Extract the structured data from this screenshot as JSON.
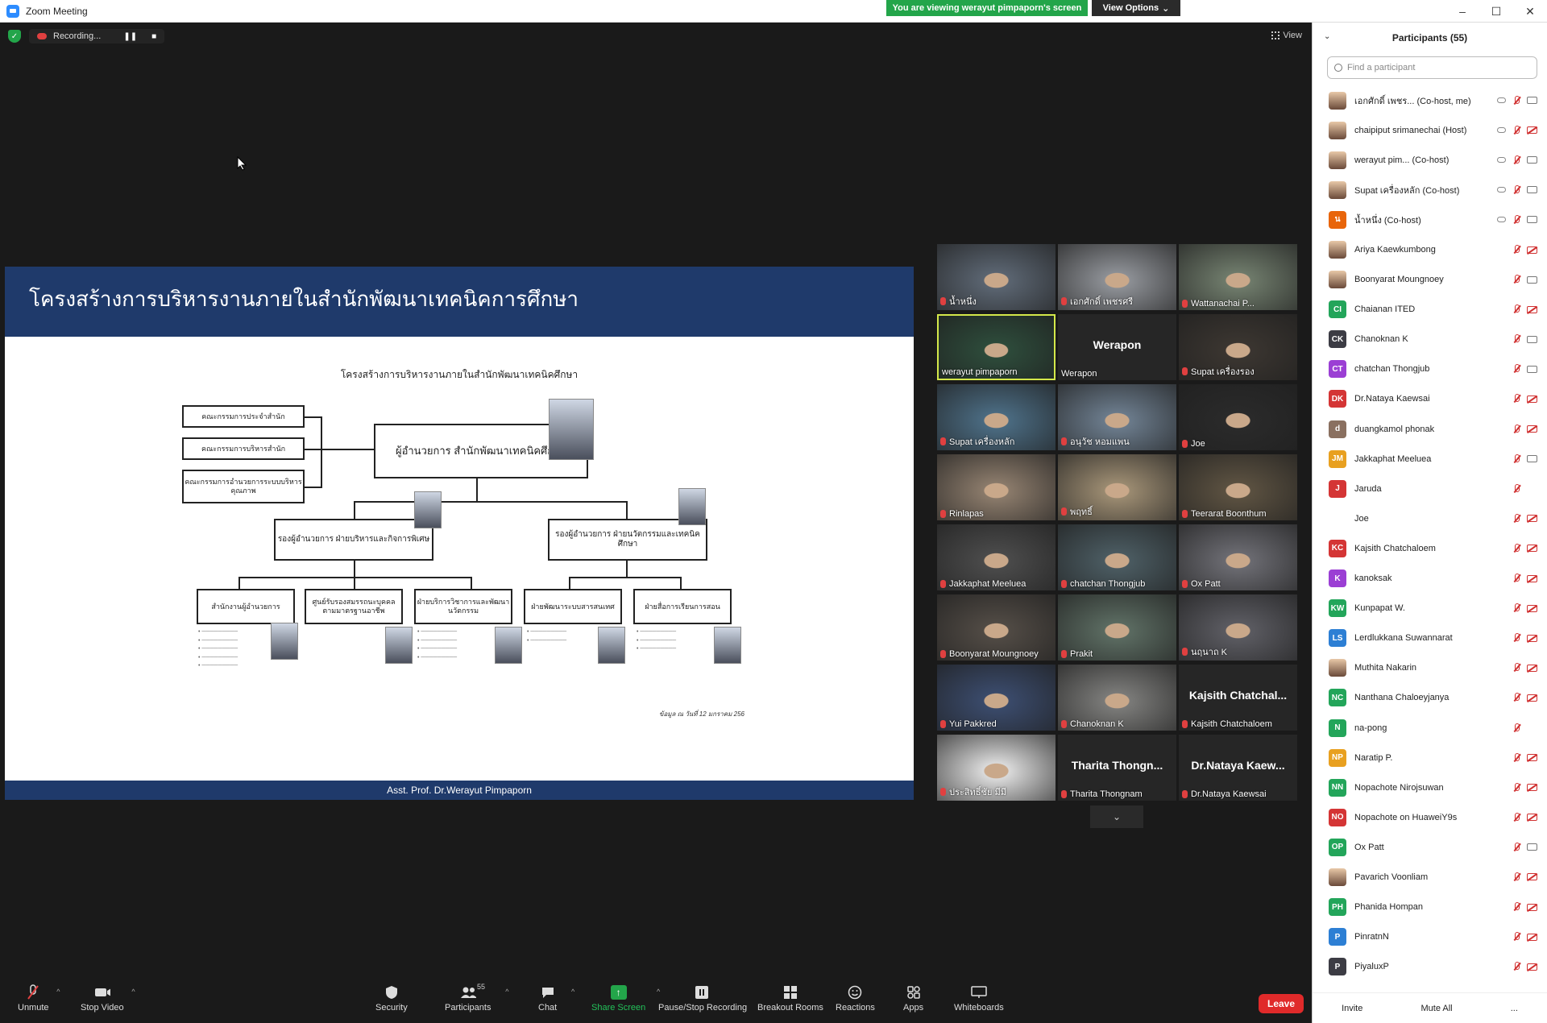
{
  "window": {
    "title": "Zoom Meeting"
  },
  "banner": {
    "viewing_text": "You are viewing werayut pimpaporn's screen",
    "view_options": "View Options"
  },
  "stage": {
    "recording_label": "Recording...",
    "view_label": "View"
  },
  "slide": {
    "header": "โครงสร้างการบริหารงานภายในสำนักพัฒนาเทคนิคการศึกษา",
    "chart_title": "โครงสร้างการบริหารงานภายในสำนักพัฒนาเทคนิคศึกษา",
    "committees": [
      "คณะกรรมการประจำสำนัก",
      "คณะกรรมการบริหารสำนัก",
      "คณะกรรมการอำนวยการระบบบริหารคุณภาพ"
    ],
    "director": "ผู้อำนวยการ สำนักพัฒนาเทคนิคศึกษา",
    "deputies": [
      "รองผู้อำนวยการ ฝ่ายบริหารและกิจการพิเศษ",
      "รองผู้อำนวยการ ฝ่ายนวัตกรรมและเทคนิคศึกษา"
    ],
    "units": [
      "สำนักงานผู้อำนวยการ",
      "ศูนย์รับรองสมรรถนะบุคคลตามมาตรฐานอาชีพ",
      "ฝ่ายบริการวิชาการและพัฒนานวัตกรรม",
      "ฝ่ายพัฒนาระบบสารสนเทศ",
      "ฝ่ายสื่อการเรียนการสอน"
    ],
    "date_note": "ข้อมูล ณ วันที่ 12 มกราคม 256",
    "footer": "Asst. Prof. Dr.Werayut Pimpaporn"
  },
  "video_tiles": [
    {
      "name": "น้ำหนึ่ง",
      "big": ""
    },
    {
      "name": "เอกศักดิ์  เพชรศรี",
      "big": ""
    },
    {
      "name": "Wattanachai P...",
      "big": ""
    },
    {
      "name": "werayut pimpaporn",
      "big": ""
    },
    {
      "name": "Werapon",
      "big": "Werapon"
    },
    {
      "name": "Supat เครื่องรอง",
      "big": ""
    },
    {
      "name": "Supat เครื่องหลัก",
      "big": ""
    },
    {
      "name": "อนุวัช  หอมแพน",
      "big": ""
    },
    {
      "name": "Joe",
      "big": ""
    },
    {
      "name": "Rinlapas",
      "big": ""
    },
    {
      "name": "พฤทธิ์",
      "big": ""
    },
    {
      "name": "Teerarat Boonthum",
      "big": ""
    },
    {
      "name": "Jakkaphat Meeluea",
      "big": ""
    },
    {
      "name": "chatchan Thongjub",
      "big": ""
    },
    {
      "name": "Ox Patt",
      "big": ""
    },
    {
      "name": "Boonyarat Moungnoey",
      "big": ""
    },
    {
      "name": "Prakit",
      "big": ""
    },
    {
      "name": "นฤนาถ  K",
      "big": ""
    },
    {
      "name": "Yui Pakkred",
      "big": ""
    },
    {
      "name": "Chanoknan K",
      "big": ""
    },
    {
      "name": "Kajsith Chatchaloem",
      "big": "Kajsith  Chatchal..."
    },
    {
      "name": "ประสิทธิ์ชัย  มีมี",
      "big": ""
    },
    {
      "name": "Tharita Thongnam",
      "big": "Tharita  Thongn..."
    },
    {
      "name": "Dr.Nataya Kaewsai",
      "big": "Dr.Nataya  Kaew..."
    }
  ],
  "panel": {
    "title": "Participants (55)",
    "search_placeholder": "Find a participant",
    "participants": [
      {
        "name": "เอกศักดิ์  เพชร...  (Co-host, me)",
        "initials": "",
        "color": "",
        "cam": "on",
        "cloud": true
      },
      {
        "name": "chaipiput srimanechai (Host)",
        "initials": "",
        "color": "",
        "cam": "off",
        "cloud": true
      },
      {
        "name": "werayut pim...  (Co-host)",
        "initials": "",
        "color": "",
        "cam": "on",
        "cloud": true
      },
      {
        "name": "Supat เครื่องหลัก (Co-host)",
        "initials": "",
        "color": "",
        "cam": "on",
        "cloud": true
      },
      {
        "name": "น้ำหนึ่ง (Co-host)",
        "initials": "น",
        "color": "#e8650a",
        "cam": "on",
        "cloud": true
      },
      {
        "name": "Ariya Kaewkumbong",
        "initials": "",
        "color": "",
        "cam": "off",
        "cloud": false
      },
      {
        "name": "Boonyarat Moungnoey",
        "initials": "",
        "color": "",
        "cam": "on",
        "cloud": false
      },
      {
        "name": "Chaianan ITED",
        "initials": "CI",
        "color": "#23a55a",
        "cam": "off",
        "cloud": false
      },
      {
        "name": "Chanoknan K",
        "initials": "CK",
        "color": "#3c3c44",
        "cam": "on",
        "cloud": false
      },
      {
        "name": "chatchan Thongjub",
        "initials": "CT",
        "color": "#9b3fd4",
        "cam": "on",
        "cloud": false
      },
      {
        "name": "Dr.Nataya Kaewsai",
        "initials": "DK",
        "color": "#d43535",
        "cam": "off",
        "cloud": false
      },
      {
        "name": "duangkamol phonak",
        "initials": "d",
        "color": "#8a7060",
        "cam": "off",
        "cloud": false
      },
      {
        "name": "Jakkaphat Meeluea",
        "initials": "JM",
        "color": "#e8a020",
        "cam": "on",
        "cloud": false
      },
      {
        "name": "Jaruda",
        "initials": "J",
        "color": "#d43535",
        "cam": "none",
        "cloud": false
      },
      {
        "name": "Joe",
        "initials": "",
        "color": "#ffffff",
        "cam": "off",
        "cloud": false
      },
      {
        "name": "Kajsith Chatchaloem",
        "initials": "KC",
        "color": "#d43535",
        "cam": "off",
        "cloud": false
      },
      {
        "name": "kanoksak",
        "initials": "K",
        "color": "#9b3fd4",
        "cam": "off",
        "cloud": false
      },
      {
        "name": "Kunpapat W.",
        "initials": "KW",
        "color": "#23a55a",
        "cam": "off",
        "cloud": false
      },
      {
        "name": "Lerdlukkana Suwannarat",
        "initials": "LS",
        "color": "#2d7fd4",
        "cam": "off",
        "cloud": false
      },
      {
        "name": "Muthita Nakarin",
        "initials": "",
        "color": "",
        "cam": "off",
        "cloud": false
      },
      {
        "name": "Nanthana Chaloeyjanya",
        "initials": "NC",
        "color": "#23a55a",
        "cam": "off",
        "cloud": false
      },
      {
        "name": "na-pong",
        "initials": "N",
        "color": "#23a55a",
        "cam": "none",
        "cloud": false
      },
      {
        "name": "Naratip P.",
        "initials": "NP",
        "color": "#e8a020",
        "cam": "off",
        "cloud": false
      },
      {
        "name": "Nopachote Nirojsuwan",
        "initials": "NN",
        "color": "#23a55a",
        "cam": "off",
        "cloud": false
      },
      {
        "name": "Nopachote on HuaweiY9s",
        "initials": "NO",
        "color": "#d43535",
        "cam": "off",
        "cloud": false
      },
      {
        "name": "Ox Patt",
        "initials": "OP",
        "color": "#23a55a",
        "cam": "on",
        "cloud": false
      },
      {
        "name": "Pavarich Voonliam",
        "initials": "",
        "color": "",
        "cam": "off",
        "cloud": false
      },
      {
        "name": "Phanida Hompan",
        "initials": "PH",
        "color": "#23a55a",
        "cam": "off",
        "cloud": false
      },
      {
        "name": "PinratnN",
        "initials": "P",
        "color": "#2d7fd4",
        "cam": "off",
        "cloud": false
      },
      {
        "name": "PiyaluxP",
        "initials": "P",
        "color": "#3c3c44",
        "cam": "off",
        "cloud": false
      }
    ],
    "invite": "Invite",
    "mute_all": "Mute All",
    "more": "..."
  },
  "toolbar": {
    "unmute": "Unmute",
    "stop_video": "Stop Video",
    "security": "Security",
    "participants": "Participants",
    "participants_count": "55",
    "chat": "Chat",
    "share_screen": "Share Screen",
    "pause_recording": "Pause/Stop Recording",
    "breakout": "Breakout Rooms",
    "reactions": "Reactions",
    "apps": "Apps",
    "whiteboards": "Whiteboards",
    "leave": "Leave"
  }
}
